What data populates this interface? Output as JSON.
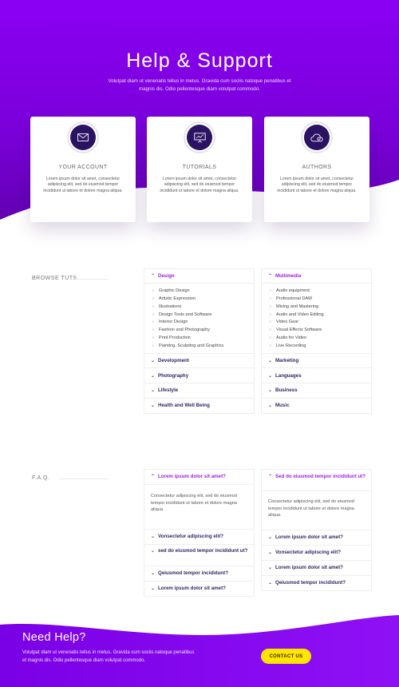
{
  "hero": {
    "title": "Help & Support",
    "subtitle": "Volutpat diam ut venenatis tellus in metus. Gravida cum sociis natoque penatibus et magnis dis. Odio pellentesque diam volutpat commodo."
  },
  "cards": [
    {
      "icon": "envelope-icon",
      "title": "YOUR ACCOUNT",
      "text": "Lorem ipsum dolor sit amet, consectetur adipiscing elit, sed do eiusmod tempor incididunt ut labore et dolore magna aliqua."
    },
    {
      "icon": "presentation-board-icon",
      "title": "TUTORIALS",
      "text": "Lorem ipsum dolor sit amet, consectetur adipiscing elit, sed do eiusmod tempor incididunt ut labore et dolore magna aliqua."
    },
    {
      "icon": "cloud-settings-icon",
      "title": "AUTHORS",
      "text": "Lorem ipsum dolor sit amet, consectetur adipiscing elit, sed do eiusmod tempor incididunt ut labore et dolore magna aliqua."
    }
  ],
  "browse": {
    "label": "BROWSE TUTS",
    "left": {
      "open_title": "Design",
      "items": [
        "Graphic Design",
        "Artistic Expression",
        "Illustrations",
        "Design Tools and Software",
        "Interior Design",
        "Fashion and Photography",
        "Print Production",
        "Painting, Sculpting and Graphics"
      ],
      "rows": [
        "Development",
        "Photography",
        "Lifestyle",
        "Health and Well Being"
      ]
    },
    "right": {
      "open_title": "Multimedia",
      "items": [
        "Audio equipment",
        "Professional DAW",
        "Mixing and Mastering",
        "Audio and Video Editing",
        "Video Gear",
        "Visual Effects Software",
        "Audio for Video",
        "Live Recording"
      ],
      "rows": [
        "Marketing",
        "Languages",
        "Business",
        "Music"
      ]
    }
  },
  "faq": {
    "label": "F.A.Q.",
    "left": {
      "open_title": "Lorem ipsum dolor sit amet?",
      "answer": "Consectetur adipiscing elit, sed do eiusmod tempor incididunt ut labore et dolore magna aliqua.",
      "rows": [
        "Vonsectetur adipiscing elit?",
        "sed do eiusmod tempor incididunt ut?",
        "Qeiusmod tempor incididunt?",
        "Lorem ipsum dolor sit amet?"
      ]
    },
    "right": {
      "open_title": "Sed do eiusmod tempor incididunt ut?",
      "answer": "Consectetur adipiscing elit, sed do eiusmod tempor incididunt ut labore et dolore magna aliqua.",
      "rows": [
        "Lorem ipsum dolor sit amet?",
        "Vonsectetur adipiscing elit?",
        "Lorem ipsum dolor sit amet?",
        "Qeiusmod tempor incididunt?"
      ]
    }
  },
  "footer": {
    "title": "Need Help?",
    "text": "Volutpat diam ut venenatis tellus in metus. Gravida cum sociis natoque penatibus et magnis dis. Odio pellentesque diam volutpat commodo.",
    "cta": "CONTACT US"
  },
  "colors": {
    "brand_purple": "#8a00f2",
    "accent_text": "#9b1fe6",
    "navy_text": "#2d2966",
    "icon_disc": "#2a1362",
    "cta_yellow": "#ffe500"
  }
}
